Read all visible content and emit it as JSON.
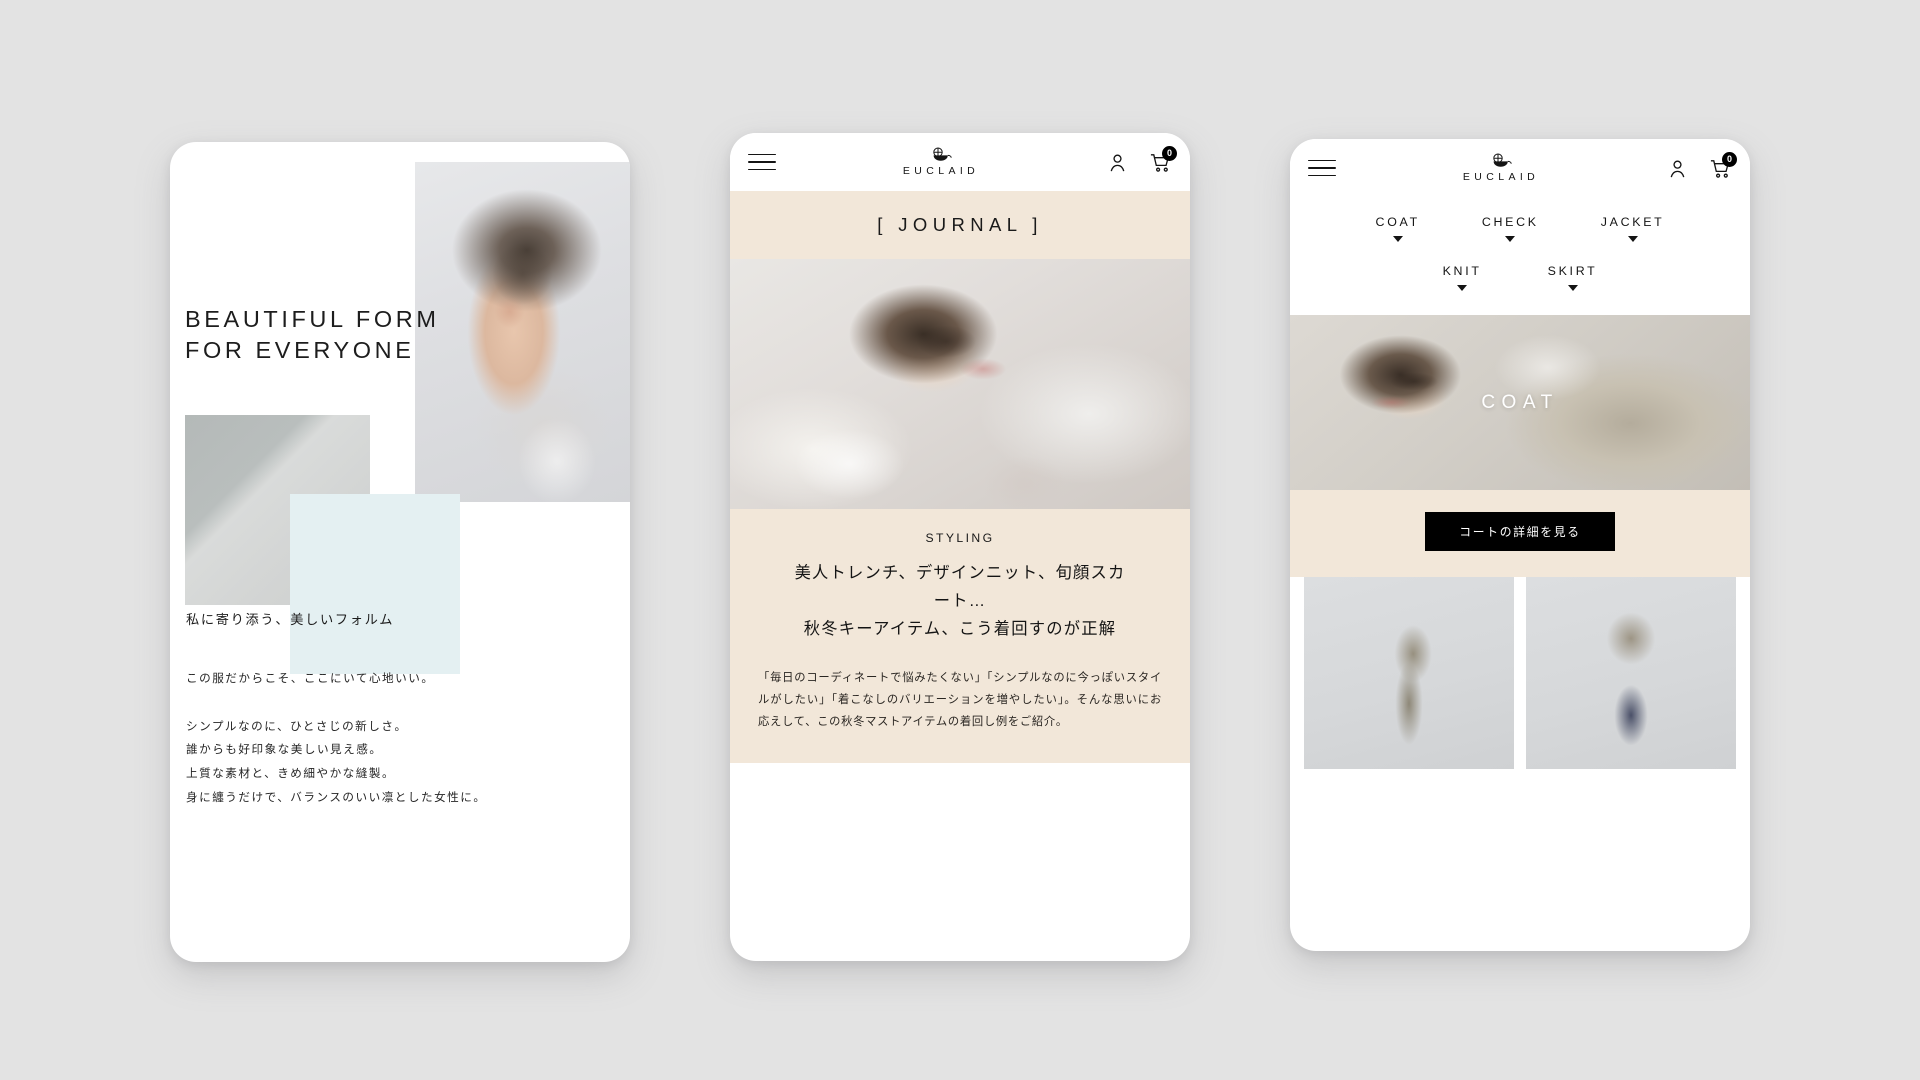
{
  "brand": {
    "name": "EUCLAID",
    "mark_icon": "euclaid-circle-mark"
  },
  "panel1": {
    "hero_title": "BEAUTIFUL FORM\nFOR EVERYONE",
    "lead": "私に寄り添う、美しいフォルム",
    "body": "この服だからこそ、ここにいて心地いい。\n\nシンプルなのに、ひとさじの新しさ。\n誰からも好印象な美しい見え感。\n上質な素材と、きめ細やかな縫製。\n身に纏うだけで、バランスのいい凛とした女性に。",
    "images": {
      "portrait_alt": "model-portrait",
      "fabric_alt": "fabric-texture",
      "mint_block_color": "#e4f0f2"
    }
  },
  "panel2": {
    "header": {
      "menu_icon": "hamburger-icon",
      "account_icon": "person-icon",
      "cart_icon": "shopping-cart-icon",
      "cart_count": "0"
    },
    "band_title": "[ JOURNAL ]",
    "band_color": "#f2e7d9",
    "hero_alt": "journal-hero-model",
    "kicker": "STYLING",
    "title": "美人トレンチ、デザインニット、旬顔スカ\nート…\n秋冬キーアイテム、こう着回すのが正解",
    "description": "「毎日のコーディネートで悩みたくない」「シンプルなのに今っぽいスタイルがしたい」「着こなしのバリエーションを増やしたい」。そんな思いにお応えして、この秋冬マストアイテムの着回し例をご紹介。"
  },
  "panel3": {
    "header": {
      "menu_icon": "hamburger-icon",
      "account_icon": "person-icon",
      "cart_icon": "shopping-cart-icon",
      "cart_count": "0"
    },
    "nav_row1": [
      {
        "label": "COAT",
        "caret": "chevron-down-icon"
      },
      {
        "label": "CHECK",
        "caret": "chevron-down-icon"
      },
      {
        "label": "JACKET",
        "caret": "chevron-down-icon"
      }
    ],
    "nav_row2": [
      {
        "label": "KNIT",
        "caret": "chevron-down-icon"
      },
      {
        "label": "SKIRT",
        "caret": "chevron-down-icon"
      }
    ],
    "hero_label": "COAT",
    "hero_alt": "coat-category-hero",
    "cta_label": "コートの詳細を見る",
    "cta_bg": "#000000",
    "band_color": "#f2e7d9",
    "thumbs": [
      {
        "alt": "trench-coat-side-view"
      },
      {
        "alt": "trench-coat-with-check-skirt"
      }
    ]
  }
}
